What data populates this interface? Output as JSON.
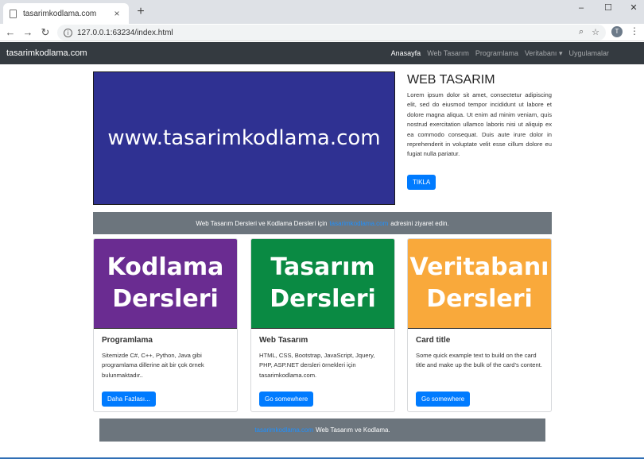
{
  "browser": {
    "tab_title": "tasarimkodlama.com",
    "tab_close": "×",
    "new_tab": "+",
    "url": "127.0.0.1:63234/index.html",
    "profile_initial": "T",
    "minimize": "–",
    "maximize": "☐",
    "close": "✕"
  },
  "navbar": {
    "brand": "tasarimkodlama.com",
    "links": [
      "Anasayfa",
      "Web Tasarım",
      "Programlama",
      "Veritabanı ▾",
      "Uygulamalar"
    ]
  },
  "hero": {
    "image_text": "www.tasarimkodlama.com",
    "image_color": "#2f3192",
    "title": "WEB TASARIM",
    "text": "Lorem ipsum dolor sit amet, consectetur adipiscing elit, sed do eiusmod tempor incididunt ut labore et dolore magna aliqua. Ut enim ad minim veniam, quis nostrud exercitation ullamco laboris nisi ut aliquip ex ea commodo consequat. Duis aute irure dolor in reprehenderit in voluptate velit esse cillum dolore eu fugiat nulla pariatur.",
    "button": "TIKLA"
  },
  "banner": {
    "before": "Web Tasarım Dersleri ve Kodlama Dersleri için",
    "link": "tasarimkodlama.com",
    "after": "adresini ziyaret edin."
  },
  "cards": [
    {
      "img_line1": "Kodlama",
      "img_line2": "Dersleri",
      "img_color": "#6a2c91",
      "title": "Programlama",
      "text": "Sitemizde C#, C++, Python, Java gibi programlama dillerine ait bir çok örnek bulunmaktadır..",
      "button": "Daha Fazlası..."
    },
    {
      "img_line1": "Tasarım",
      "img_line2": "Dersleri",
      "img_color": "#0a8a43",
      "title": "Web Tasarım",
      "text": "HTML, CSS, Bootstrap, JavaScript, Jquery, PHP, ASP.NET dersleri örnekleri için tasarimkodlama.com.",
      "button": "Go somewhere"
    },
    {
      "img_line1": "Veritabanı",
      "img_line2": "Dersleri",
      "img_color": "#f9a93b",
      "title": "Card title",
      "text": "Some quick example text to build on the card title and make up the bulk of the card's content.",
      "button": "Go somewhere"
    }
  ],
  "footer": {
    "link": "tasarimkodlama.com",
    "text": "Web Tasarım ve Kodlama."
  },
  "colors": {
    "navbar_bg": "#343a40",
    "primary": "#007bff",
    "secondary": "#6c757d"
  }
}
